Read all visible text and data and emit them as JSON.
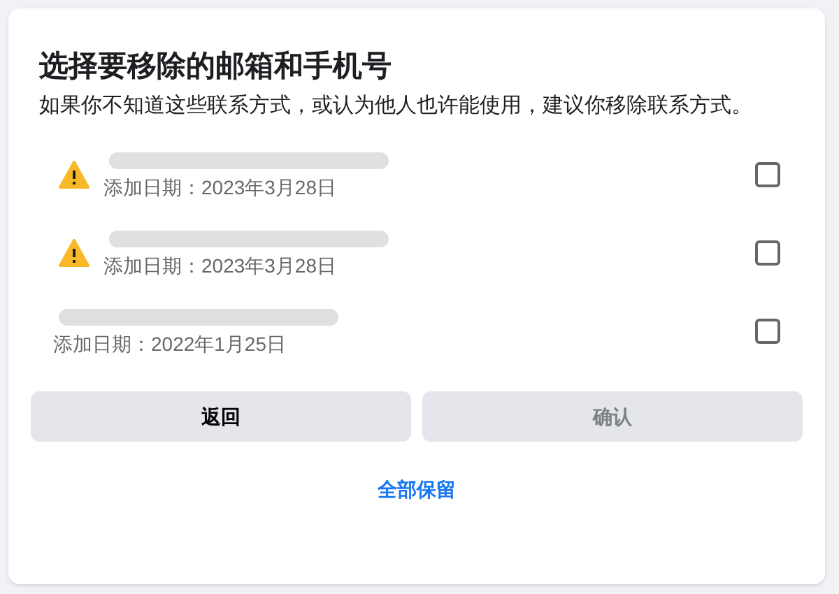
{
  "dialog": {
    "title": "选择要移除的邮箱和手机号",
    "description": "如果你不知道这些联系方式，或认为他人也许能使用，建议你移除联系方式。"
  },
  "contacts": [
    {
      "warning": true,
      "added": "添加日期：2023年3月28日",
      "checked": false
    },
    {
      "warning": true,
      "added": "添加日期：2023年3月28日",
      "checked": false
    },
    {
      "warning": false,
      "added": "添加日期：2022年1月25日",
      "checked": false
    }
  ],
  "buttons": [
    {
      "label": "返回",
      "disabled": false
    },
    {
      "label": "确认",
      "disabled": true
    }
  ],
  "link": "全部保留"
}
